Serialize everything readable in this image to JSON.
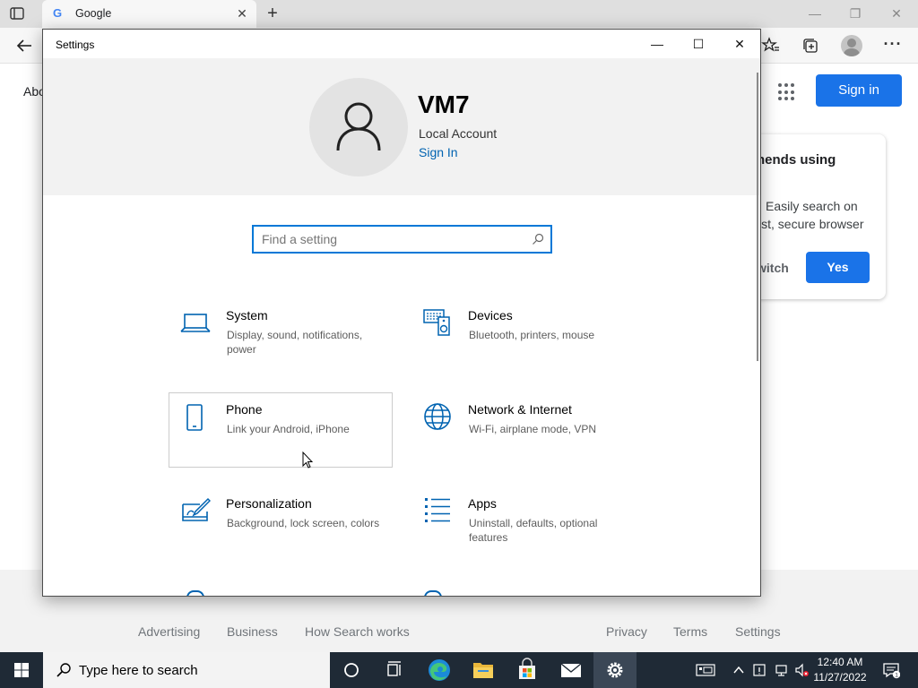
{
  "browser": {
    "tab_title": "Google",
    "tab_favicon": "G",
    "new_tab": "+",
    "page": {
      "about_link": "Abo",
      "signin_label": "Sign in",
      "promo": {
        "heading": "nends using",
        "text_line1": "Easily search on",
        "text_line2": "ist, secure browser",
        "switch_label": "witch",
        "yes_label": "Yes"
      },
      "footer_links": [
        "Advertising",
        "Business",
        "How Search works",
        "Privacy",
        "Terms",
        "Settings"
      ]
    }
  },
  "settings": {
    "window_title": "Settings",
    "user": {
      "name": "VM7",
      "account_type": "Local Account",
      "signin_link": "Sign In"
    },
    "search": {
      "placeholder": "Find a setting"
    },
    "categories": [
      {
        "name": "System",
        "description": "Display, sound, notifications, power",
        "icon": "laptop-icon"
      },
      {
        "name": "Devices",
        "description": "Bluetooth, printers, mouse",
        "icon": "keyboard-speaker-icon"
      },
      {
        "name": "Phone",
        "description": "Link your Android, iPhone",
        "icon": "phone-icon"
      },
      {
        "name": "Network & Internet",
        "description": "Wi-Fi, airplane mode, VPN",
        "icon": "globe-icon"
      },
      {
        "name": "Personalization",
        "description": "Background, lock screen, colors",
        "icon": "paint-brush-icon"
      },
      {
        "name": "Apps",
        "description": "Uninstall, defaults, optional features",
        "icon": "apps-list-icon"
      }
    ]
  },
  "taskbar": {
    "search_placeholder": "Type here to search",
    "clock_time": "12:40 AM",
    "clock_date": "11/27/2022",
    "notification_count": "1",
    "accent_color": "#76b9ed"
  },
  "colors": {
    "settings_accent": "#0078d7",
    "link_blue": "#0063b1",
    "google_blue": "#1a73e8"
  }
}
